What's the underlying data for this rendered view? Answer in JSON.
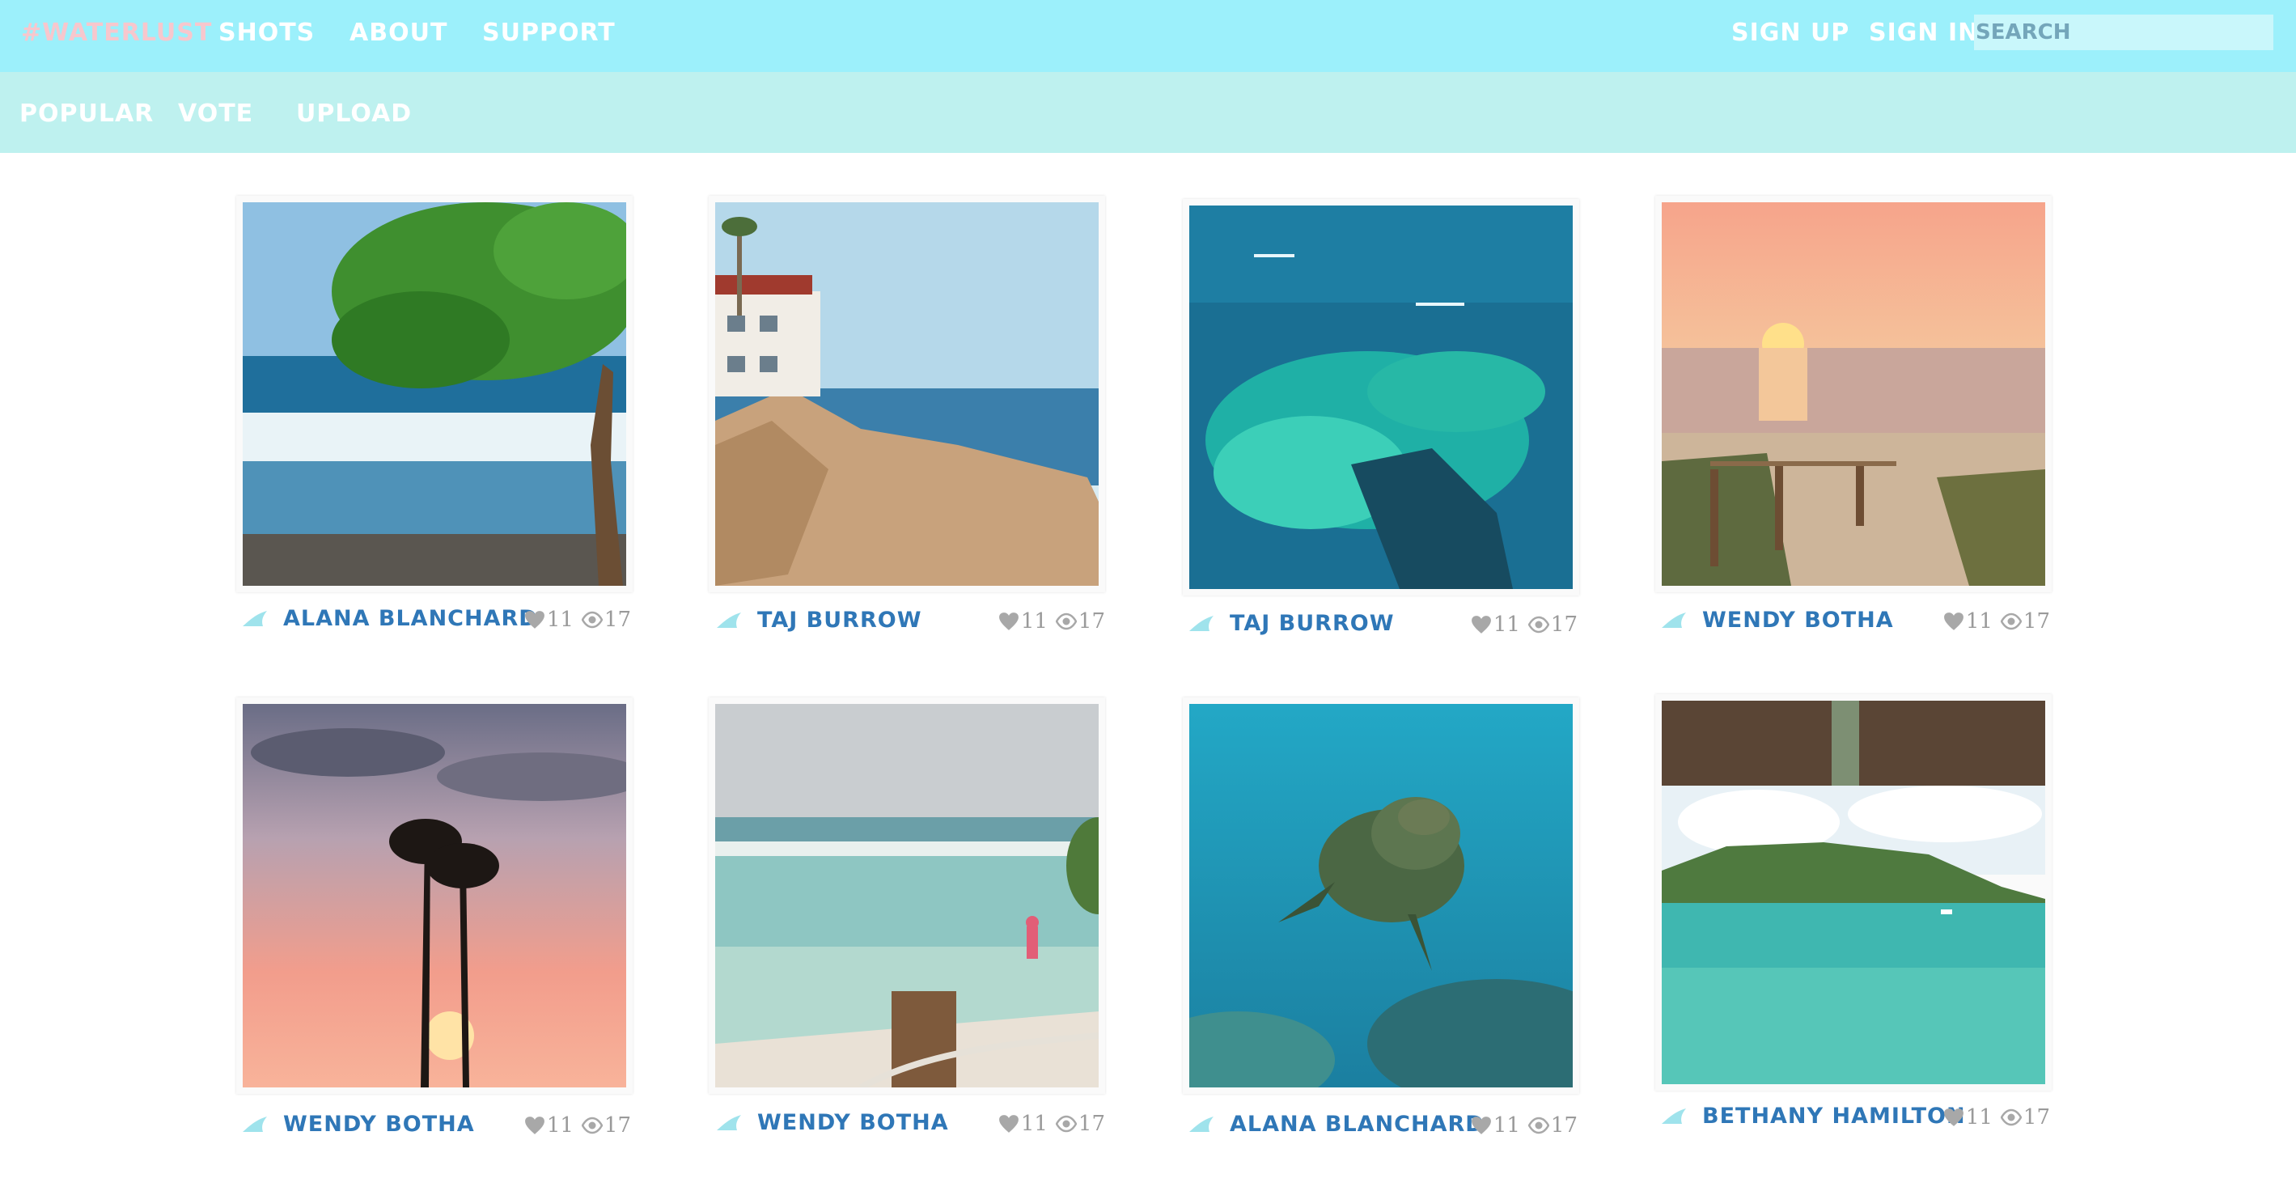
{
  "header": {
    "brand": "#WATERLUST",
    "nav": [
      "SHOTS",
      "ABOUT",
      "SUPPORT"
    ],
    "sign_up": "SIGN UP",
    "sign_in": "SIGN IN",
    "search_placeholder": "SEARCH"
  },
  "subnav": [
    "POPULAR",
    "VOTE",
    "UPLOAD"
  ],
  "colors": {
    "topbar": "#9cf0fb",
    "subbar": "#bef1ef",
    "author": "#2f77b7",
    "brand": "#f7c7cd"
  },
  "shots": [
    {
      "author": "ALANA BLANCHARD",
      "likes": "11",
      "views": "17",
      "scene": "beach-tree"
    },
    {
      "author": "TAJ BURROW",
      "likes": "11",
      "views": "17",
      "scene": "cliff-house"
    },
    {
      "author": "TAJ BURROW",
      "likes": "11",
      "views": "17",
      "scene": "aerial-reef"
    },
    {
      "author": "WENDY BOTHA",
      "likes": "11",
      "views": "17",
      "scene": "sunset-path"
    },
    {
      "author": "WENDY BOTHA",
      "likes": "11",
      "views": "17",
      "scene": "palm-sunset"
    },
    {
      "author": "WENDY BOTHA",
      "likes": "11",
      "views": "17",
      "scene": "shore-wader"
    },
    {
      "author": "ALANA BLANCHARD",
      "likes": "11",
      "views": "17",
      "scene": "sea-turtle"
    },
    {
      "author": "BETHANY HAMILTON",
      "likes": "11",
      "views": "17",
      "scene": "pier-view"
    }
  ]
}
